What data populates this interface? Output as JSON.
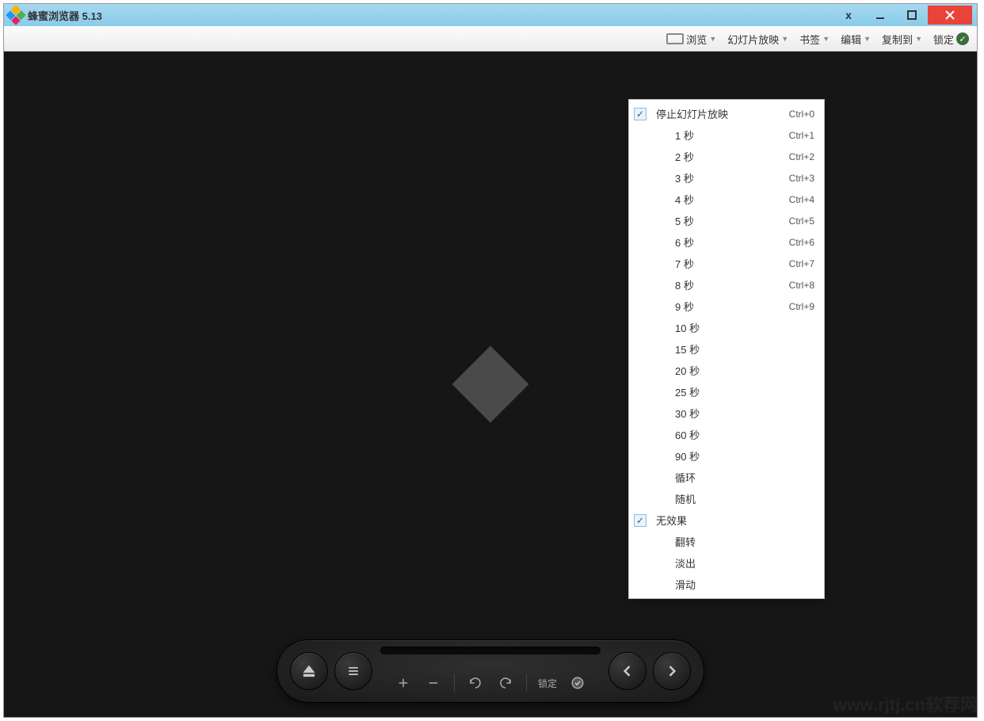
{
  "title": "蜂蜜浏览器 5.13",
  "toolbar": {
    "browse": "浏览",
    "slideshow": "幻灯片放映",
    "bookmark": "书签",
    "edit": "编辑",
    "copyto": "复制到",
    "lock": "锁定"
  },
  "dropdown": {
    "items": [
      {
        "label": "停止幻灯片放映",
        "shortcut": "Ctrl+0",
        "checked": true
      },
      {
        "label": "1 秒",
        "shortcut": "Ctrl+1",
        "checked": false
      },
      {
        "label": "2 秒",
        "shortcut": "Ctrl+2",
        "checked": false
      },
      {
        "label": "3 秒",
        "shortcut": "Ctrl+3",
        "checked": false
      },
      {
        "label": "4 秒",
        "shortcut": "Ctrl+4",
        "checked": false
      },
      {
        "label": "5 秒",
        "shortcut": "Ctrl+5",
        "checked": false
      },
      {
        "label": "6 秒",
        "shortcut": "Ctrl+6",
        "checked": false
      },
      {
        "label": "7 秒",
        "shortcut": "Ctrl+7",
        "checked": false
      },
      {
        "label": "8 秒",
        "shortcut": "Ctrl+8",
        "checked": false
      },
      {
        "label": "9 秒",
        "shortcut": "Ctrl+9",
        "checked": false
      },
      {
        "label": "10 秒",
        "shortcut": "",
        "checked": false
      },
      {
        "label": "15 秒",
        "shortcut": "",
        "checked": false
      },
      {
        "label": "20 秒",
        "shortcut": "",
        "checked": false
      },
      {
        "label": "25 秒",
        "shortcut": "",
        "checked": false
      },
      {
        "label": "30 秒",
        "shortcut": "",
        "checked": false
      },
      {
        "label": "60 秒",
        "shortcut": "",
        "checked": false
      },
      {
        "label": "90 秒",
        "shortcut": "",
        "checked": false
      },
      {
        "label": "循环",
        "shortcut": "",
        "checked": false
      },
      {
        "label": "随机",
        "shortcut": "",
        "checked": false
      },
      {
        "label": "无效果",
        "shortcut": "",
        "checked": true
      },
      {
        "label": "翻转",
        "shortcut": "",
        "checked": false
      },
      {
        "label": "淡出",
        "shortcut": "",
        "checked": false
      },
      {
        "label": "滑动",
        "shortcut": "",
        "checked": false
      }
    ]
  },
  "bottombar": {
    "lock_label": "锁定"
  },
  "watermark": "www.rjtj.cn软荐网"
}
